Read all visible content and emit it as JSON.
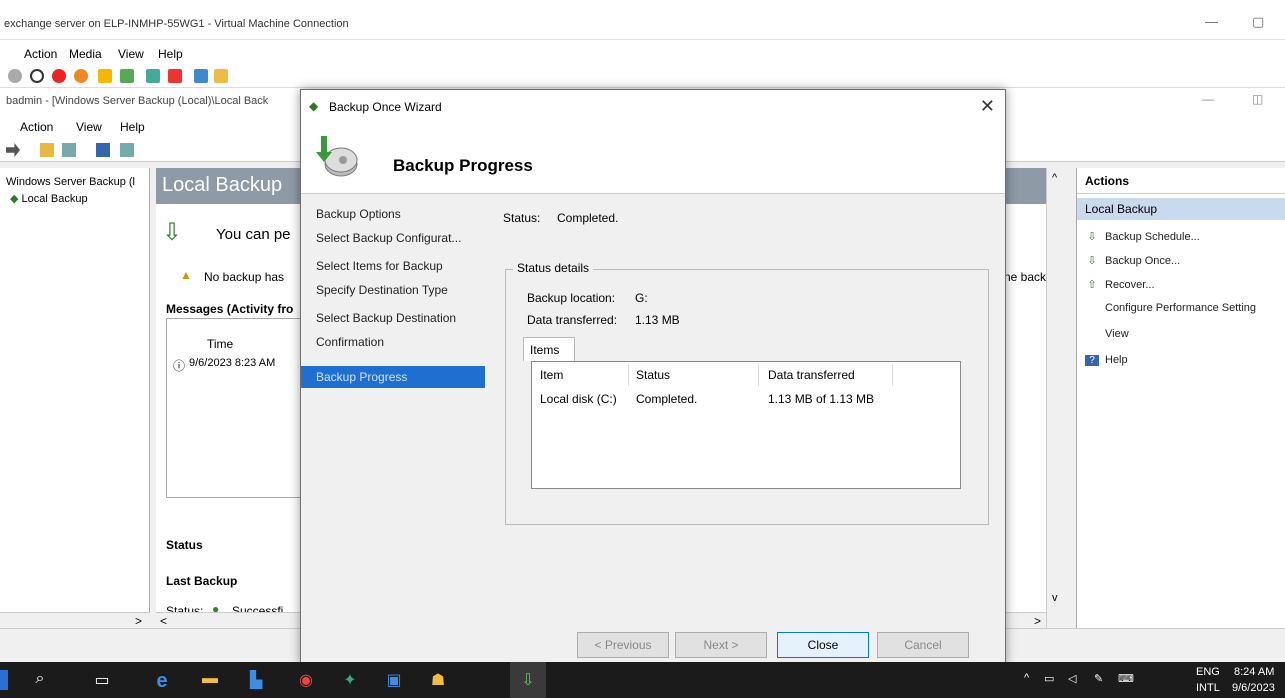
{
  "vm": {
    "title": "exchange server on ELP-INMHP-55WG1 - Virtual Machine Connection",
    "menu": [
      "Action",
      "Media",
      "View",
      "Help"
    ],
    "minimize": "—",
    "maximize": "▢"
  },
  "mmc": {
    "title": "badmin - [Windows Server Backup (Local)\\Local Back",
    "menu": [
      "Action",
      "View",
      "Help"
    ],
    "minimize": "—",
    "restore": "◫"
  },
  "tree": {
    "root": "Windows Server Backup (l",
    "child": "Local Backup",
    "scroll_right": ">"
  },
  "center": {
    "header": "Local Backup",
    "intro": "You can pe",
    "warning": "No backup has",
    "right_clip": "ne backu",
    "messages_title": "Messages (Activity fro",
    "time_col": "Time",
    "time_val": "9/6/2023 8:23 AM",
    "status_title": "Status",
    "last_backup": "Last Backup",
    "status_row": "Status:",
    "status_val": "Successfi",
    "scroll_left": "<",
    "scroll_up": "^",
    "scroll_down": "v",
    "scroll_right": ">"
  },
  "actions": {
    "header": "Actions",
    "section": "Local Backup",
    "items": [
      {
        "label": "Backup Schedule..."
      },
      {
        "label": "Backup Once..."
      },
      {
        "label": "Recover..."
      },
      {
        "label": "Configure Performance Setting"
      },
      {
        "label": "View"
      },
      {
        "label": "Help"
      }
    ]
  },
  "dialog": {
    "title": "Backup Once Wizard",
    "close": "✕",
    "heading": "Backup Progress",
    "nav": [
      "Backup Options",
      "Select Backup Configurat...",
      "Select Items for Backup",
      "Specify Destination Type",
      "Select Backup Destination",
      "Confirmation"
    ],
    "nav_selected": "Backup Progress",
    "status_label": "Status:",
    "status_value": "Completed.",
    "details_title": "Status details",
    "location_label": "Backup location:",
    "location_value": "G:",
    "transferred_label": "Data transferred:",
    "transferred_value": "1.13 MB",
    "tab": "Items",
    "columns": [
      "Item",
      "Status",
      "Data transferred"
    ],
    "rows": [
      {
        "item": "Local disk (C:)",
        "status": "Completed.",
        "data": "1.13 MB of 1.13 MB"
      }
    ],
    "buttons": {
      "previous": "< Previous",
      "next": "Next >",
      "close": "Close",
      "cancel": "Cancel"
    }
  },
  "taskbar": {
    "lang_top": "ENG",
    "lang_bottom": "INTL",
    "time": "8:24 AM",
    "date": "9/6/2023"
  },
  "colors": {
    "selection": "#1f6fd1",
    "center_header": "#8e9aa6",
    "action_section": "#c9d9ee"
  }
}
